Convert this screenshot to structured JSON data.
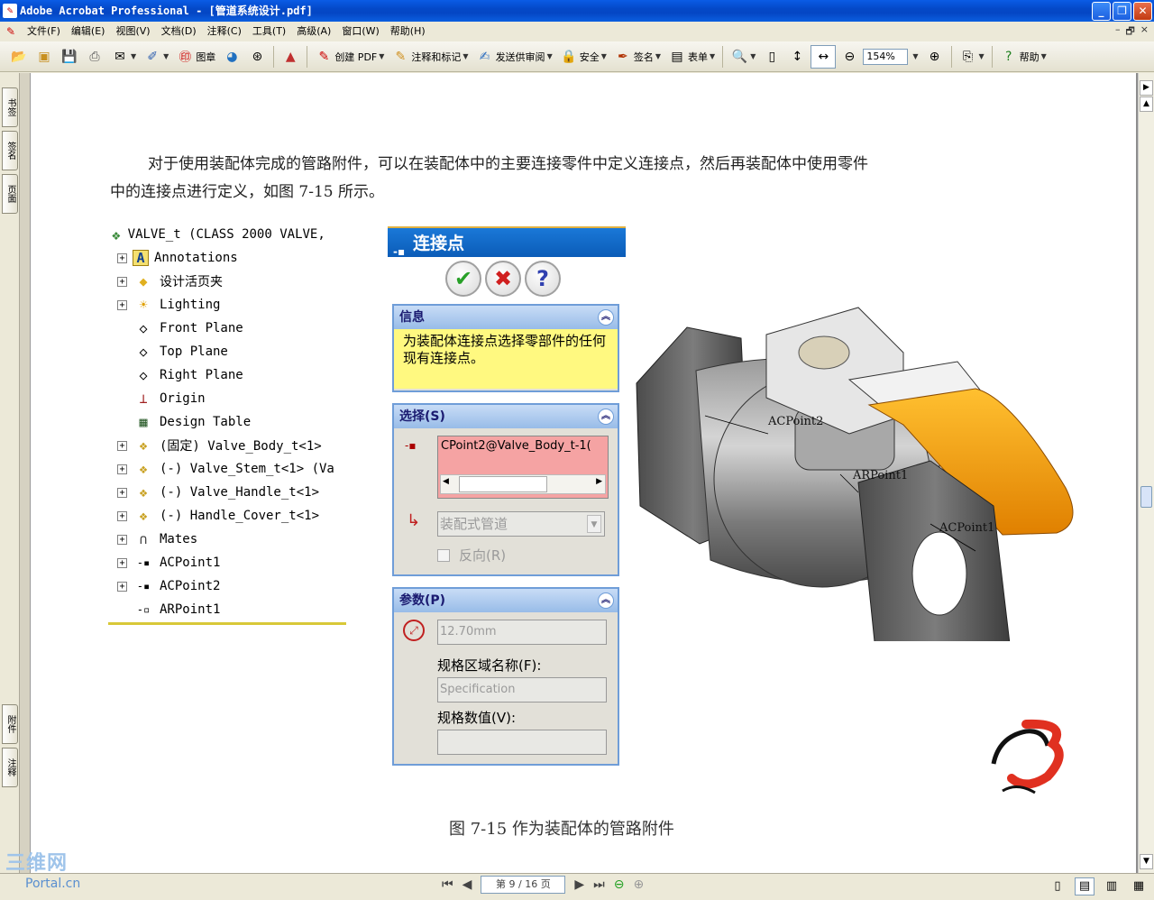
{
  "window": {
    "title": "Adobe Acrobat Professional - [管道系统设计.pdf]",
    "controls": [
      "_",
      "❐",
      "✕"
    ]
  },
  "menu": [
    "文件(F)",
    "编辑(E)",
    "视图(V)",
    "文档(D)",
    "注释(C)",
    "工具(T)",
    "高级(A)",
    "窗口(W)",
    "帮助(H)"
  ],
  "mdi_controls": [
    "–",
    "🗗",
    "×"
  ],
  "toolbar": {
    "stamp": "图章",
    "create_pdf": "创建 PDF",
    "comment_markup": "注释和标记",
    "send_review": "发送供审阅",
    "security": "安全",
    "sign": "签名",
    "forms": "表单",
    "zoom": "154%",
    "help": "帮助"
  },
  "left_tabs": {
    "bookmarks": "书签",
    "signatures": "签名",
    "pages": "页面",
    "attachments": "附件",
    "comments": "注释"
  },
  "document": {
    "paragraph_line1": "对于使用装配体完成的管路附件，可以在装配体中的主要连接零件中定义连接点，然后再装配体中使用零件",
    "paragraph_line2": "中的连接点进行定义，如图 7-15 所示。",
    "caption": "图 7-15 作为装配体的管路附件"
  },
  "tree": {
    "root": "VALVE_t  (CLASS 2000 VALVE,",
    "items": [
      {
        "label": "Annotations",
        "icon": "A"
      },
      {
        "label": "设计活页夹",
        "icon": "◆"
      },
      {
        "label": "Lighting",
        "icon": "☀"
      },
      {
        "label": "Front Plane",
        "icon": "◇"
      },
      {
        "label": "Top Plane",
        "icon": "◇"
      },
      {
        "label": "Right Plane",
        "icon": "◇"
      },
      {
        "label": "Origin",
        "icon": "⊥"
      },
      {
        "label": "Design Table",
        "icon": "▦"
      },
      {
        "label": "(固定) Valve_Body_t<1>",
        "icon": "❖"
      },
      {
        "label": "(-) Valve_Stem_t<1> (Va",
        "icon": "❖"
      },
      {
        "label": "(-) Valve_Handle_t<1>",
        "icon": "❖"
      },
      {
        "label": "(-) Handle_Cover_t<1>",
        "icon": "❖"
      },
      {
        "label": "Mates",
        "icon": "∩"
      },
      {
        "label": "ACPoint1",
        "icon": "-▪"
      },
      {
        "label": "ACPoint2",
        "icon": "-▪"
      },
      {
        "label": "ARPoint1",
        "icon": "-▫"
      }
    ]
  },
  "property_manager": {
    "title": "连接点",
    "info_header": "信息",
    "info_text": "为装配体连接点选择零部件的任何现有连接点。",
    "selection_header": "选择(S)",
    "selection_value": "CPoint2@Valve_Body_t-1(",
    "type_value": "装配式管道",
    "reverse_label": "反向(R)",
    "params_header": "参数(P)",
    "diameter_value": "12.70mm",
    "spec_name_label": "规格区域名称(F):",
    "spec_name_value": "Specification",
    "spec_value_label": "规格数值(V):",
    "spec_value_value": ""
  },
  "model_labels": {
    "acpoint2": "ACPoint2",
    "arpoint1": "ARPoint1",
    "acpoint1": "ACPoint1"
  },
  "status": {
    "page_display": "第 9 / 16 页"
  },
  "watermark": {
    "big": "三维网",
    "small": "Portal.cn"
  }
}
